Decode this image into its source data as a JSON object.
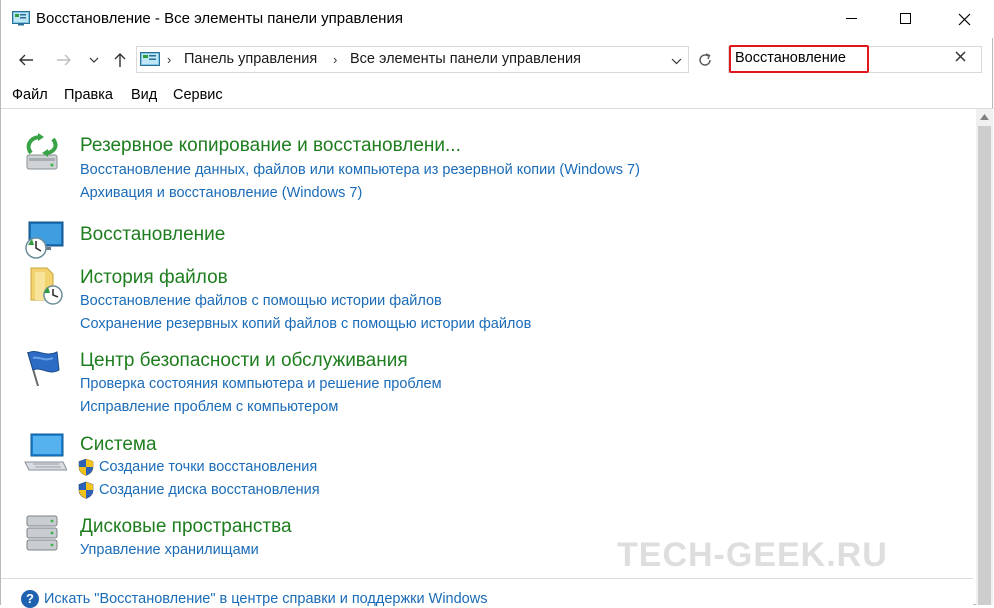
{
  "window": {
    "title": "Восстановление - Все элементы панели управления"
  },
  "address": {
    "crumbs": [
      "Панель управления",
      "Все элементы панели управления"
    ]
  },
  "search": {
    "value": "Восстановление"
  },
  "menu": [
    "Файл",
    "Правка",
    "Вид",
    "Сервис"
  ],
  "groups": [
    {
      "icon": "backup-restore-icon",
      "title": "Резервное копирование и восстановлени...",
      "links": [
        "Восстановление данных, файлов или компьютера из резервной копии (Windows 7)",
        "Архивация и восстановление (Windows 7)"
      ]
    },
    {
      "icon": "recovery-icon",
      "title": "Восстановление",
      "links": []
    },
    {
      "icon": "file-history-icon",
      "title": "История файлов",
      "links": [
        "Восстановление файлов с помощью истории файлов",
        "Сохранение резервных копий файлов с помощью истории файлов"
      ]
    },
    {
      "icon": "security-maintenance-flag-icon",
      "title": "Центр безопасности и обслуживания",
      "links": [
        "Проверка состояния компьютера и решение проблем",
        "Исправление проблем с компьютером"
      ]
    },
    {
      "icon": "system-icon",
      "title": "Система",
      "links": [
        "Создание точки восстановления",
        "Создание диска восстановления"
      ]
    },
    {
      "icon": "storage-spaces-icon",
      "title": "Дисковые пространства",
      "links": [
        "Управление хранилищами"
      ]
    }
  ],
  "help": {
    "link": "Искать \"Восстановление\" в центре справки и поддержки Windows"
  },
  "watermark": "TECH-GEEK.RU",
  "colors": {
    "group_title": "#1e7d1e",
    "link": "#1a6bb8",
    "search_highlight": "#e0181b"
  }
}
